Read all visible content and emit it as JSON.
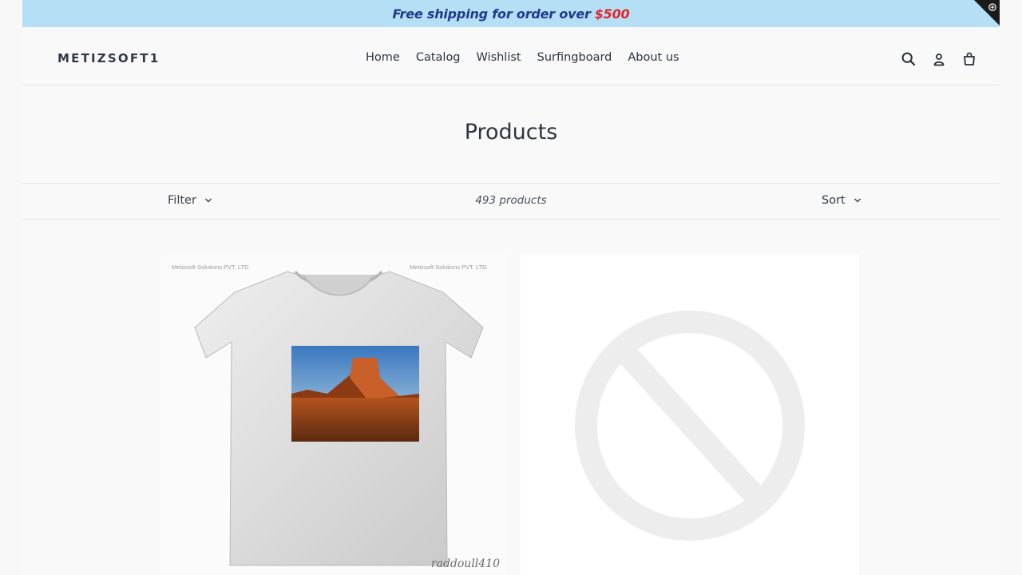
{
  "announcement": {
    "text": "Free shipping for order over",
    "amount": "$500"
  },
  "header": {
    "logo": "METIZSOFT1",
    "nav": [
      "Home",
      "Catalog",
      "Wishlist",
      "Surfingboard",
      "About us"
    ],
    "icons": [
      "search-icon",
      "account-icon",
      "cart-icon"
    ]
  },
  "page": {
    "title": "Products"
  },
  "toolbar": {
    "filter_label": "Filter",
    "count_label": "493 products",
    "sort_label": "Sort"
  },
  "products": [
    {
      "watermark_left": "Metizsoft Solutions PVT. LTD",
      "watermark_right": "Metizsoft Solutions PVT. LTD",
      "signature": "raddoull410"
    },
    {
      "image": "placeholder-unavailable"
    }
  ],
  "colors": {
    "announce_bg": "#b5dff5",
    "announce_text": "#223a8a",
    "announce_accent": "#e0262a",
    "text": "#2b2f3a"
  }
}
